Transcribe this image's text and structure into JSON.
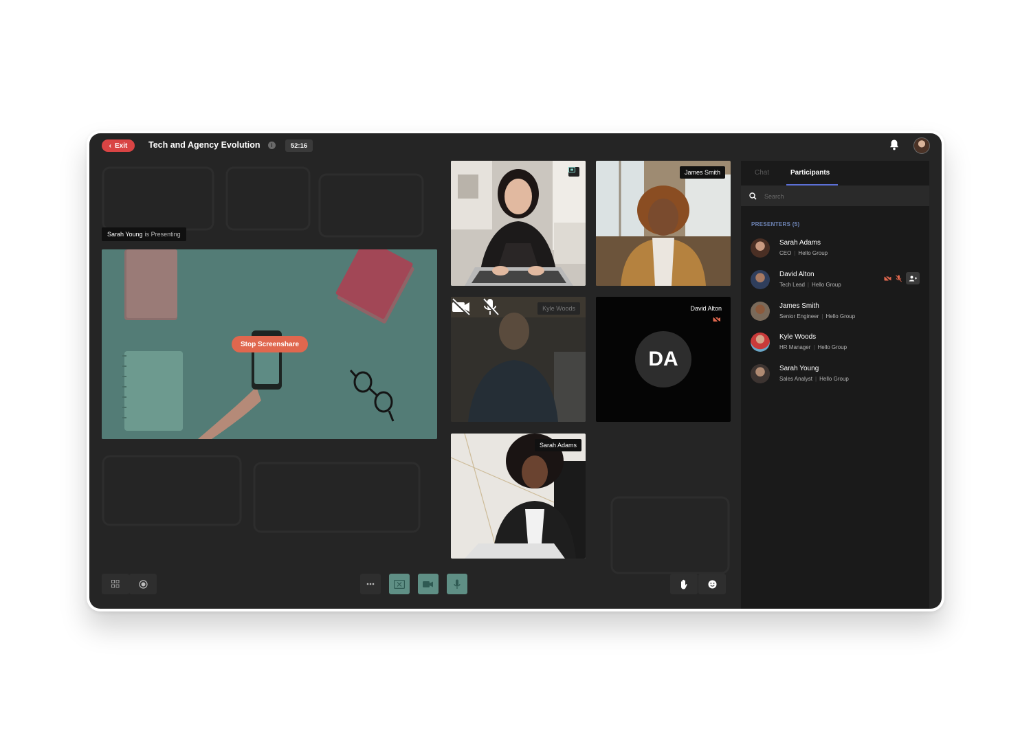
{
  "header": {
    "exit_label": "Exit",
    "meeting_title": "Tech and Agency Evolution",
    "info_icon": "i",
    "timer": "52:16"
  },
  "presenting": {
    "presenter": "Sarah Young",
    "suffix": "is Presenting",
    "stop_label": "Stop Screenshare"
  },
  "tiles": [
    {
      "name": "",
      "has_screen_badge": true
    },
    {
      "name": "James Smith"
    },
    {
      "name": "Kyle Woods",
      "camera_off": true,
      "mic_off": true
    },
    {
      "name": "David Alton",
      "initials": "DA",
      "camera_off": true
    },
    {
      "name": "Sarah Adams"
    }
  ],
  "panel": {
    "tabs": [
      "Chat",
      "Participants"
    ],
    "active_tab": "Participants",
    "search_placeholder": "Search",
    "section_title": "PRESENTERS (5)",
    "participants": [
      {
        "name": "Sarah Adams",
        "role": "CEO",
        "org": "Hello Group"
      },
      {
        "name": "David Alton",
        "role": "Tech Lead",
        "org": "Hello Group",
        "camera_off": true,
        "mic_off": true
      },
      {
        "name": "James Smith",
        "role": "Senior Engineer",
        "org": "Hello Group"
      },
      {
        "name": "Kyle Woods",
        "role": "HR Manager",
        "org": "Hello Group"
      },
      {
        "name": "Sarah Young",
        "role": "Sales Analyst",
        "org": "Hello Group"
      }
    ]
  },
  "colors": {
    "accent": "#5b6fd6",
    "exit": "#d94444",
    "stop": "#e0674e",
    "control_active": "#5f8f85",
    "active_tile_border": "#7fd1c6",
    "muted_red": "#e0674e"
  }
}
